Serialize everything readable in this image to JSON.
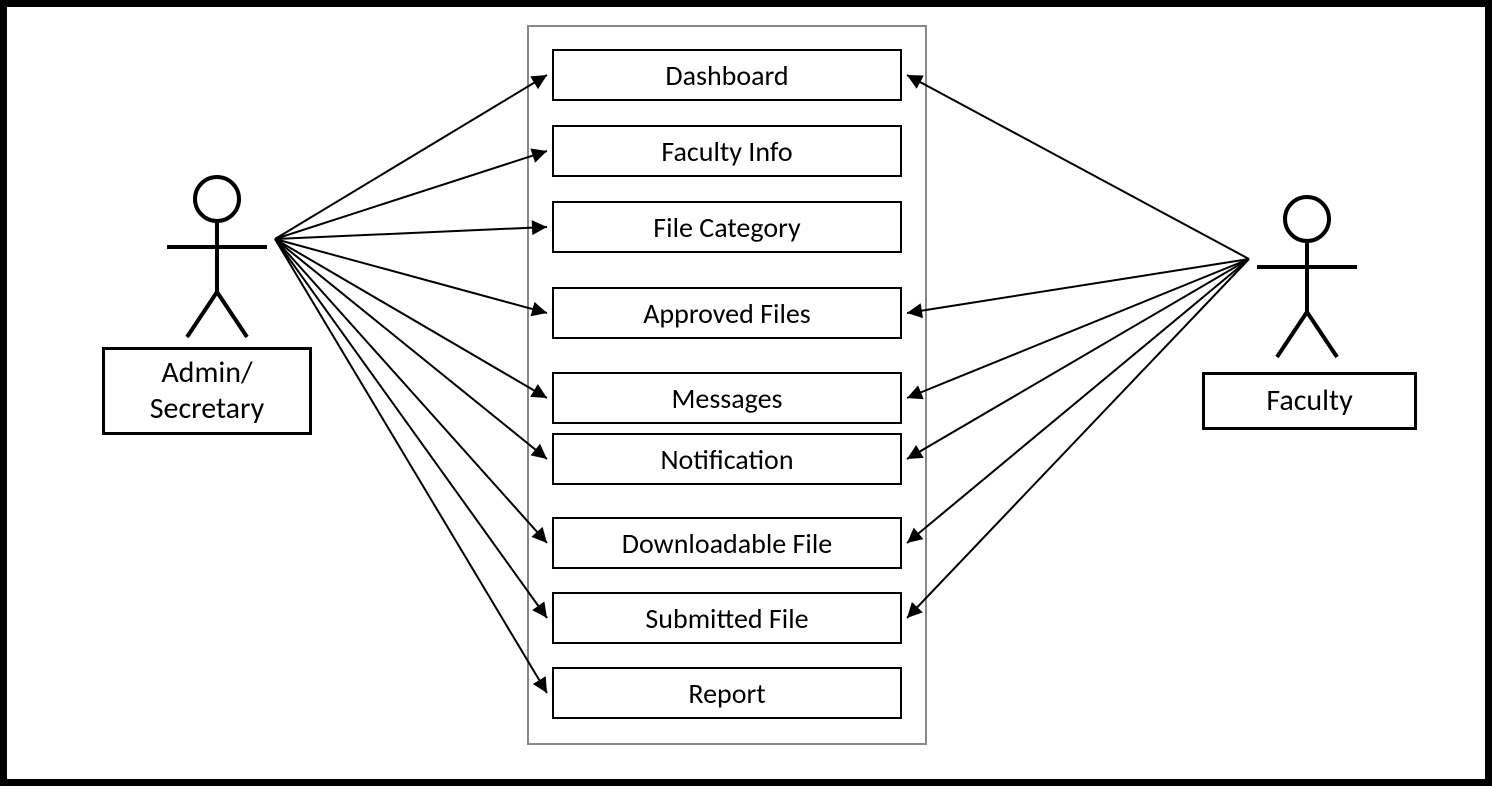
{
  "actors": {
    "left": {
      "label": "Admin/\nSecretary"
    },
    "right": {
      "label": "Faculty"
    }
  },
  "usecases": [
    {
      "label": "Dashboard"
    },
    {
      "label": "Faculty Info"
    },
    {
      "label": "File Category"
    },
    {
      "label": "Approved Files"
    },
    {
      "label": "Messages"
    },
    {
      "label": "Notification"
    },
    {
      "label": "Downloadable File"
    },
    {
      "label": "Submitted File"
    },
    {
      "label": "Report"
    }
  ]
}
